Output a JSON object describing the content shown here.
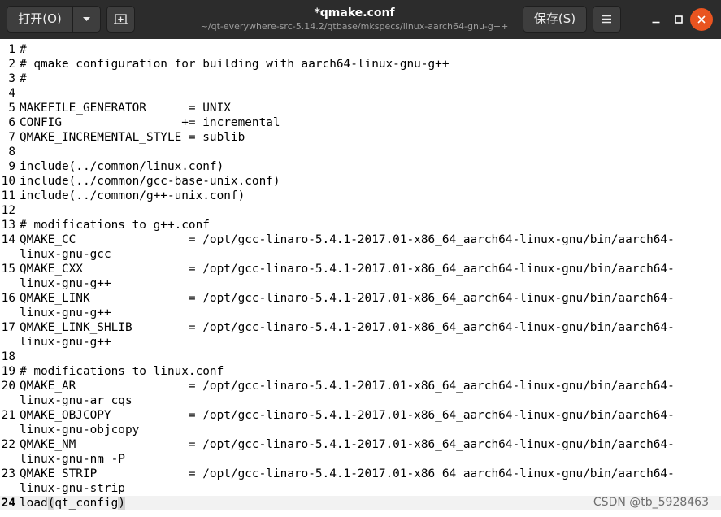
{
  "header": {
    "open_label": "打开(O)",
    "save_label": "保存(S)",
    "title": "*qmake.conf",
    "subtitle": "~/qt-everywhere-src-5.14.2/qtbase/mkspecs/linux-aarch64-gnu-g++",
    "open_arrow_icon": "chevron-down-icon",
    "new_tab_icon": "new-tab-icon",
    "menu_icon": "hamburger-menu-icon",
    "minimize_icon": "minimize-icon",
    "maximize_icon": "maximize-icon",
    "close_icon": "close-icon",
    "close_color": "#e95420"
  },
  "editor": {
    "current_line": 24,
    "lines": [
      {
        "num": "1",
        "text": "#"
      },
      {
        "num": "2",
        "text": "# qmake configuration for building with aarch64-linux-gnu-g++"
      },
      {
        "num": "3",
        "text": "#"
      },
      {
        "num": "4",
        "text": ""
      },
      {
        "num": "5",
        "text": "MAKEFILE_GENERATOR      = UNIX"
      },
      {
        "num": "6",
        "text": "CONFIG                 += incremental"
      },
      {
        "num": "7",
        "text": "QMAKE_INCREMENTAL_STYLE = sublib"
      },
      {
        "num": "8",
        "text": ""
      },
      {
        "num": "9",
        "text": "include(../common/linux.conf)"
      },
      {
        "num": "10",
        "text": "include(../common/gcc-base-unix.conf)"
      },
      {
        "num": "11",
        "text": "include(../common/g++-unix.conf)"
      },
      {
        "num": "12",
        "text": ""
      },
      {
        "num": "13",
        "text": "# modifications to g++.conf"
      },
      {
        "num": "14",
        "text": "QMAKE_CC                = /opt/gcc-linaro-5.4.1-2017.01-x86_64_aarch64-linux-gnu/bin/aarch64-",
        "cont": "linux-gnu-gcc"
      },
      {
        "num": "15",
        "text": "QMAKE_CXX               = /opt/gcc-linaro-5.4.1-2017.01-x86_64_aarch64-linux-gnu/bin/aarch64-",
        "cont": "linux-gnu-g++"
      },
      {
        "num": "16",
        "text": "QMAKE_LINK              = /opt/gcc-linaro-5.4.1-2017.01-x86_64_aarch64-linux-gnu/bin/aarch64-",
        "cont": "linux-gnu-g++"
      },
      {
        "num": "17",
        "text": "QMAKE_LINK_SHLIB        = /opt/gcc-linaro-5.4.1-2017.01-x86_64_aarch64-linux-gnu/bin/aarch64-",
        "cont": "linux-gnu-g++"
      },
      {
        "num": "18",
        "text": ""
      },
      {
        "num": "19",
        "text": "# modifications to linux.conf"
      },
      {
        "num": "20",
        "text": "QMAKE_AR                = /opt/gcc-linaro-5.4.1-2017.01-x86_64_aarch64-linux-gnu/bin/aarch64-",
        "cont": "linux-gnu-ar cqs"
      },
      {
        "num": "21",
        "text": "QMAKE_OBJCOPY           = /opt/gcc-linaro-5.4.1-2017.01-x86_64_aarch64-linux-gnu/bin/aarch64-",
        "cont": "linux-gnu-objcopy"
      },
      {
        "num": "22",
        "text": "QMAKE_NM                = /opt/gcc-linaro-5.4.1-2017.01-x86_64_aarch64-linux-gnu/bin/aarch64-",
        "cont": "linux-gnu-nm -P"
      },
      {
        "num": "23",
        "text": "QMAKE_STRIP             = /opt/gcc-linaro-5.4.1-2017.01-x86_64_aarch64-linux-gnu/bin/aarch64-",
        "cont": "linux-gnu-strip"
      },
      {
        "num": "24",
        "text": "",
        "parts": [
          "load",
          "(",
          "qt_config",
          ")"
        ]
      }
    ]
  },
  "watermark": "CSDN @tb_5928463"
}
